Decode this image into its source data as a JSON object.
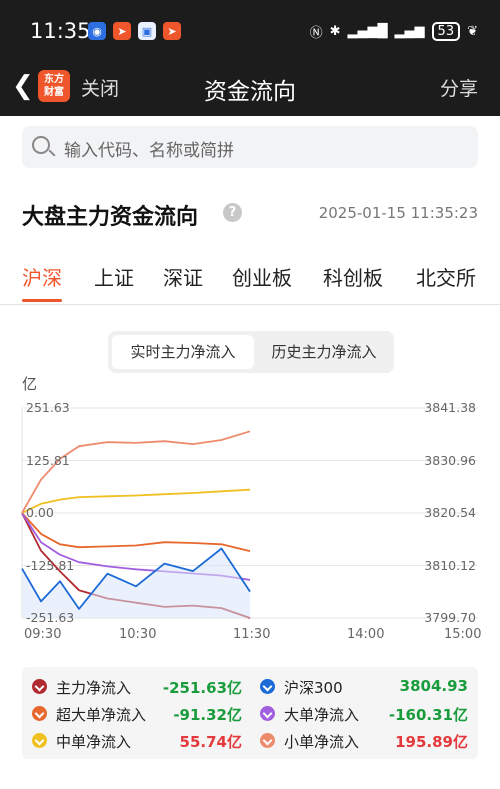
{
  "status_bar": {
    "time": "11:35",
    "battery": "53"
  },
  "nav": {
    "logo_line1": "东方",
    "logo_line2": "财富",
    "close_label": "关闭",
    "title": "资金流向",
    "share_label": "分享"
  },
  "search": {
    "placeholder": "输入代码、名称或简拼"
  },
  "section": {
    "title": "大盘主力资金流向",
    "timestamp": "2025-01-15 11:35:23"
  },
  "tabs": [
    "沪深",
    "上证",
    "深证",
    "创业板",
    "科创板",
    "北交所"
  ],
  "segment": {
    "active": "实时主力净流入",
    "other": "历史主力净流入"
  },
  "colors": {
    "accent": "#f0562b",
    "main_net": "#b02a30",
    "super_large": "#e8672c",
    "medium": "#f0c020",
    "hs300": "#1b6ad6",
    "large": "#a25ee0",
    "small": "#ee8a6c",
    "positive": "#e4393c",
    "negative": "#1a9c3c"
  },
  "chart_data": {
    "type": "line",
    "unit_label": "亿",
    "left_axis": {
      "ticks": [
        "251.63",
        "125.81",
        "0.00",
        "-125.81",
        "-251.63"
      ],
      "range": [
        -251.63,
        251.63
      ]
    },
    "right_axis": {
      "ticks": [
        "3841.38",
        "3830.96",
        "3820.54",
        "3810.12",
        "3799.70"
      ],
      "range": [
        3799.7,
        3841.38
      ]
    },
    "x_ticks": [
      "09:30",
      "10:30",
      "11:30",
      "14:00",
      "15:00"
    ],
    "x_range_minutes": [
      0,
      240
    ],
    "x": [
      0,
      10,
      20,
      30,
      45,
      60,
      75,
      90,
      105,
      120
    ],
    "series": [
      {
        "name": "主力净流入",
        "axis": "left",
        "color": "#b02a30",
        "values": [
          0,
          -90,
          -140,
          -185,
          -205,
          -215,
          -225,
          -222,
          -228,
          -251.63
        ]
      },
      {
        "name": "超大单净流入",
        "axis": "left",
        "color": "#e8672c",
        "values": [
          0,
          -50,
          -75,
          -82,
          -80,
          -78,
          -70,
          -72,
          -75,
          -91.32
        ]
      },
      {
        "name": "大单净流入",
        "axis": "left",
        "color": "#a25ee0",
        "values": [
          0,
          -70,
          -100,
          -118,
          -128,
          -135,
          -140,
          -145,
          -150,
          -160.31
        ]
      },
      {
        "name": "中单净流入",
        "axis": "left",
        "color": "#f0c020",
        "values": [
          0,
          22,
          32,
          38,
          40,
          42,
          45,
          48,
          52,
          55.74
        ]
      },
      {
        "name": "小单净流入",
        "axis": "left",
        "color": "#ee8a6c",
        "values": [
          0,
          80,
          130,
          160,
          170,
          168,
          172,
          165,
          175,
          195.89
        ]
      },
      {
        "name": "沪深300",
        "axis": "right",
        "color": "#1b6ad6",
        "values": [
          3809.5,
          3803.0,
          3807.0,
          3801.5,
          3808.5,
          3806.0,
          3810.5,
          3809.0,
          3813.5,
          3804.93
        ]
      }
    ]
  },
  "legend": [
    {
      "name": "主力净流入",
      "value": "-251.63亿",
      "color": "#b02a30",
      "sign": "neg"
    },
    {
      "name": "沪深300",
      "value": "3804.93",
      "color": "#1b6ad6",
      "sign": "neg"
    },
    {
      "name": "超大单净流入",
      "value": "-91.32亿",
      "color": "#e8672c",
      "sign": "neg"
    },
    {
      "name": "大单净流入",
      "value": "-160.31亿",
      "color": "#a25ee0",
      "sign": "neg"
    },
    {
      "name": "中单净流入",
      "value": "55.74亿",
      "color": "#f0c020",
      "sign": "pos"
    },
    {
      "name": "小单净流入",
      "value": "195.89亿",
      "color": "#ee8a6c",
      "sign": "pos"
    }
  ]
}
